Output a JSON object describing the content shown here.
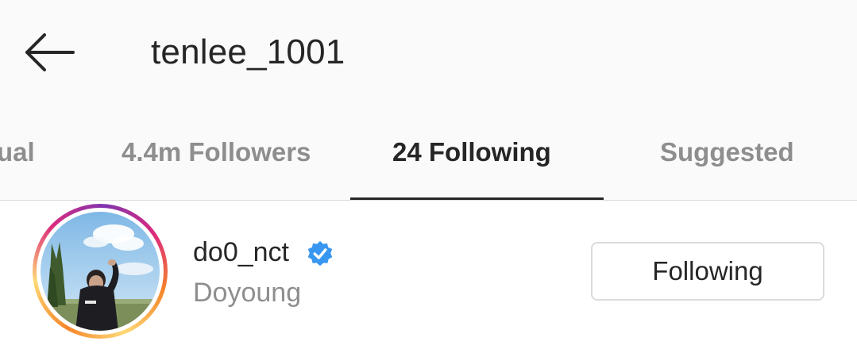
{
  "header": {
    "title": "tenlee_1001",
    "back_icon": "arrow-left-icon"
  },
  "tabs": [
    {
      "label": "Mutual",
      "visible_text": "ual",
      "active": false
    },
    {
      "label": "4.4m Followers",
      "active": false
    },
    {
      "label": "24 Following",
      "active": true
    },
    {
      "label": "Suggested",
      "active": false
    }
  ],
  "list": {
    "items": [
      {
        "username": "do0_nct",
        "verified": true,
        "verified_icon": "verified-badge-icon",
        "full_name": "Doyoung",
        "button_label": "Following",
        "avatar_icon": "profile-photo"
      }
    ]
  },
  "colors": {
    "header_bg": "#fafafa",
    "text_primary": "#262626",
    "text_secondary": "#8e8e8e",
    "verified_blue": "#3897f0",
    "border": "#dbdbdb"
  }
}
